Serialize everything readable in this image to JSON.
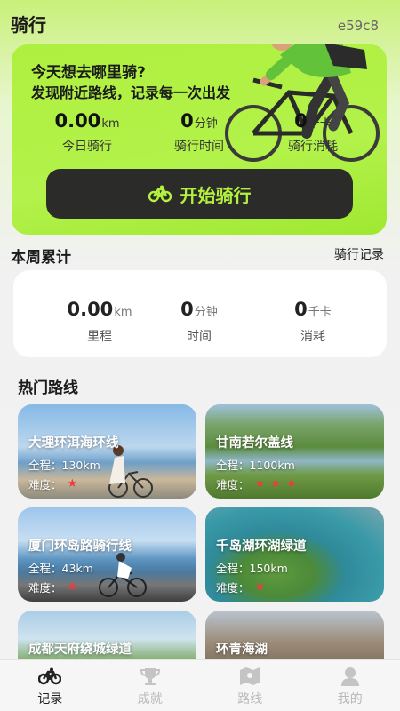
{
  "header": {
    "title": "骑行",
    "code": "e59c8"
  },
  "hero": {
    "title": "今天想去哪里骑?",
    "subtitle": "发现附近路线，记录每一次出发",
    "stats": [
      {
        "value": "0.00",
        "unit": "km",
        "label": "今日骑行"
      },
      {
        "value": "0",
        "unit": "分钟",
        "label": "骑行时间"
      },
      {
        "value": "0",
        "unit": "千卡",
        "label": "骑行消耗"
      }
    ],
    "start_button": {
      "label": "开始骑行",
      "icon": "bicycle-icon"
    },
    "accent_color": "#b4f13e"
  },
  "weekly": {
    "title": "本周累计",
    "history_link": "骑行记录",
    "stats": [
      {
        "value": "0.00",
        "unit": "km",
        "label": "里程"
      },
      {
        "value": "0",
        "unit": "分钟",
        "label": "时间"
      },
      {
        "value": "0",
        "unit": "千卡",
        "label": "消耗"
      }
    ]
  },
  "routes": {
    "title": "热门路线",
    "distance_prefix": "全程：",
    "difficulty_prefix": "难度：",
    "items": [
      {
        "name": "大理环洱海环线",
        "distance": "130km",
        "difficulty": 1
      },
      {
        "name": "甘南若尔盖线",
        "distance": "1100km",
        "difficulty": 3
      },
      {
        "name": "厦门环岛路骑行线",
        "distance": "43km",
        "difficulty": 1
      },
      {
        "name": "千岛湖环湖绿道",
        "distance": "150km",
        "difficulty": 1
      },
      {
        "name": "成都天府绕城绿道",
        "distance": "",
        "difficulty": 0
      },
      {
        "name": "环青海湖",
        "distance": "",
        "difficulty": 0
      }
    ]
  },
  "tabbar": {
    "items": [
      {
        "label": "记录",
        "icon": "bicycle-icon",
        "active": true
      },
      {
        "label": "成就",
        "icon": "trophy-icon",
        "active": false
      },
      {
        "label": "路线",
        "icon": "map-icon",
        "active": false
      },
      {
        "label": "我的",
        "icon": "user-icon",
        "active": false
      }
    ]
  }
}
